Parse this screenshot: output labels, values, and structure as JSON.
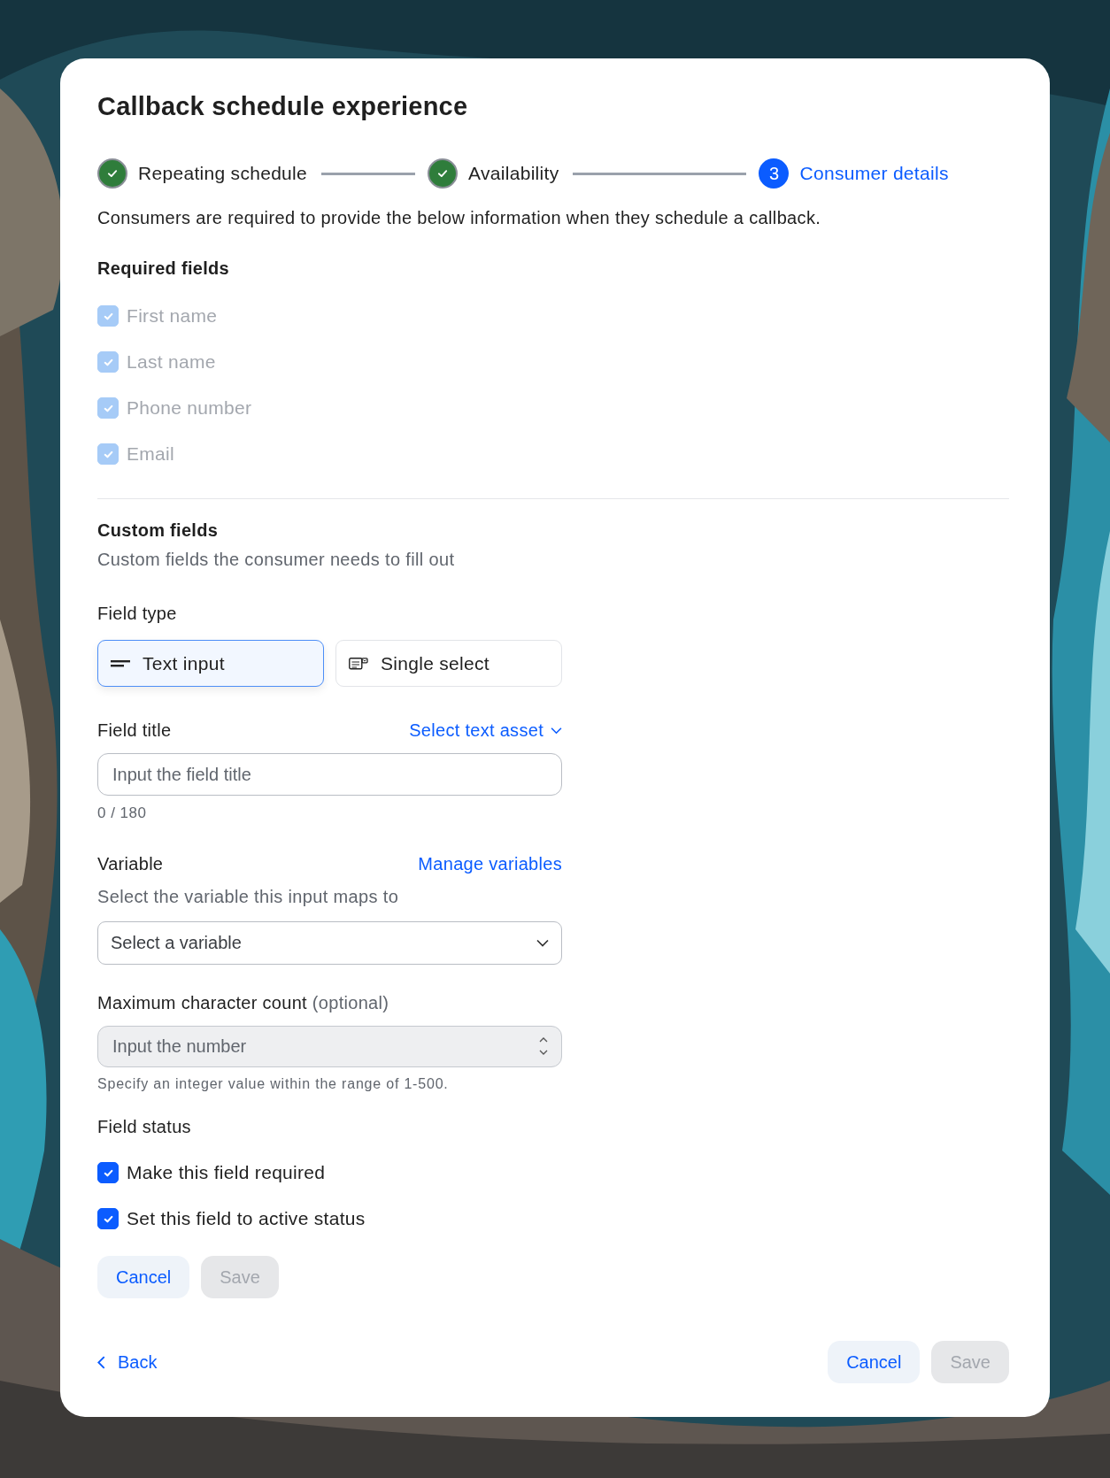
{
  "dialog": {
    "title": "Callback schedule experience"
  },
  "stepper": [
    {
      "label": "Repeating schedule",
      "completed": true,
      "selected": false
    },
    {
      "label": "Availability",
      "completed": true,
      "selected": false
    },
    {
      "label": "Consumer details",
      "completed": false,
      "selected": true,
      "number": "3"
    }
  ],
  "description": "Consumers are required to provide the below information when they schedule a callback.",
  "required_fields": {
    "heading": "Required fields",
    "items": [
      {
        "label": "First name",
        "checked": true,
        "disabled": true
      },
      {
        "label": "Last name",
        "checked": true,
        "disabled": true
      },
      {
        "label": "Phone number",
        "checked": true,
        "disabled": true
      },
      {
        "label": "Email",
        "checked": true,
        "disabled": true
      }
    ]
  },
  "custom_fields": {
    "heading": "Custom fields",
    "subtitle": "Custom fields the consumer needs to fill out"
  },
  "field_type": {
    "label": "Field type",
    "options": [
      {
        "label": "Text input",
        "kind": "text",
        "selected": true
      },
      {
        "label": "Single select",
        "kind": "select",
        "selected": false
      }
    ]
  },
  "field_title": {
    "label": "Field title",
    "link": "Select text asset",
    "placeholder": "Input the field title",
    "counter": "0 / 180"
  },
  "variable": {
    "label": "Variable",
    "link": "Manage variables",
    "hint": "Select the variable this input maps to",
    "placeholder": "Select a variable"
  },
  "max_count": {
    "label": "Maximum character count",
    "optional": "(optional)",
    "placeholder": "Input the number",
    "hint": "Specify an integer value within the range of 1-500.",
    "disabled": true
  },
  "field_status": {
    "label": "Field status",
    "items": [
      {
        "label": "Make this field required",
        "checked": true,
        "disabled": false
      },
      {
        "label": "Set this field to active status",
        "checked": true,
        "disabled": false
      }
    ]
  },
  "form_buttons": [
    {
      "label": "Cancel",
      "disabled": false
    },
    {
      "label": "Save",
      "disabled": true
    }
  ],
  "footer": {
    "back": "Back",
    "buttons": [
      {
        "label": "Cancel",
        "disabled": false
      },
      {
        "label": "Save",
        "disabled": true
      }
    ]
  }
}
